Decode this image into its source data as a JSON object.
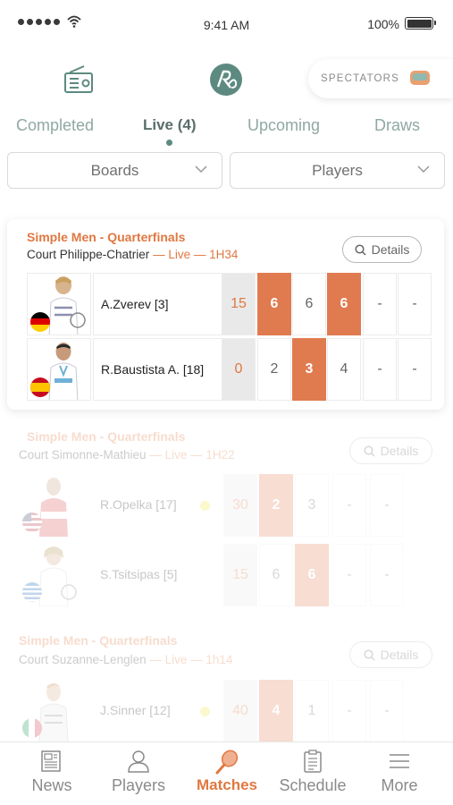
{
  "status_bar": {
    "time": "9:41 AM",
    "battery": "100%"
  },
  "header": {
    "spectators_label": "SPECTATORS"
  },
  "tabs": [
    {
      "label": "Completed",
      "active": false
    },
    {
      "label": "Live (4)",
      "active": true
    },
    {
      "label": "Upcoming",
      "active": false
    },
    {
      "label": "Draws",
      "active": false
    }
  ],
  "filters": {
    "boards": "Boards",
    "players": "Players"
  },
  "matches": [
    {
      "round": "Simple Men -  Quarterfinals",
      "court": "Court Philippe-Chatrier",
      "status": "Live",
      "duration": "1H34",
      "details_label": "Details",
      "players": [
        {
          "name": "A.Zverev [3]",
          "flag": "Germany",
          "serving": true,
          "point": "15",
          "sets": [
            "6",
            "6",
            "6",
            "-",
            "-"
          ],
          "won": [
            true,
            false,
            true,
            false,
            false
          ]
        },
        {
          "name": "R.Baustista A. [18]",
          "flag": "Spain",
          "serving": false,
          "point": "0",
          "sets": [
            "2",
            "3",
            "4",
            "-",
            "-"
          ],
          "won": [
            false,
            true,
            false,
            false,
            false
          ]
        }
      ]
    },
    {
      "round": "Simple Men -  Quarterfinals",
      "court": "Court Simonne-Mathieu",
      "status": "Live",
      "duration": "1H22",
      "details_label": "Details",
      "players": [
        {
          "name": "R.Opelka [17]",
          "flag": "USA",
          "serving": true,
          "point": "30",
          "sets": [
            "2",
            "3",
            "-",
            "-"
          ],
          "won": [
            true,
            false,
            false,
            false
          ]
        },
        {
          "name": "S.Tsitsipas [5]",
          "flag": "Greece",
          "serving": false,
          "point": "15",
          "sets": [
            "6",
            "6",
            "-",
            "-"
          ],
          "won": [
            false,
            true,
            false,
            false
          ]
        }
      ]
    },
    {
      "round": "Simple Men -  Quarterfinals",
      "court": "Court Suzanne-Lenglen",
      "status": "Live",
      "duration": "1h14",
      "details_label": "Details",
      "players": [
        {
          "name": "J.Sinner [12]",
          "flag": "Italy",
          "serving": true,
          "point": "40",
          "sets": [
            "4",
            "1",
            "-",
            "-"
          ],
          "won": [
            true,
            false,
            false,
            false
          ]
        }
      ]
    }
  ],
  "bottom_nav": [
    {
      "label": "News",
      "icon": "news-icon",
      "active": false
    },
    {
      "label": "Players",
      "icon": "player-icon",
      "active": false
    },
    {
      "label": "Matches",
      "icon": "racket-icon",
      "active": true
    },
    {
      "label": "Schedule",
      "icon": "clipboard-icon",
      "active": false
    },
    {
      "label": "More",
      "icon": "menu-icon",
      "active": false
    }
  ],
  "colors": {
    "accent": "#e07840",
    "set_win": "#e07b50",
    "brand_green": "#5d8a80",
    "serve": "#f2e43a"
  }
}
